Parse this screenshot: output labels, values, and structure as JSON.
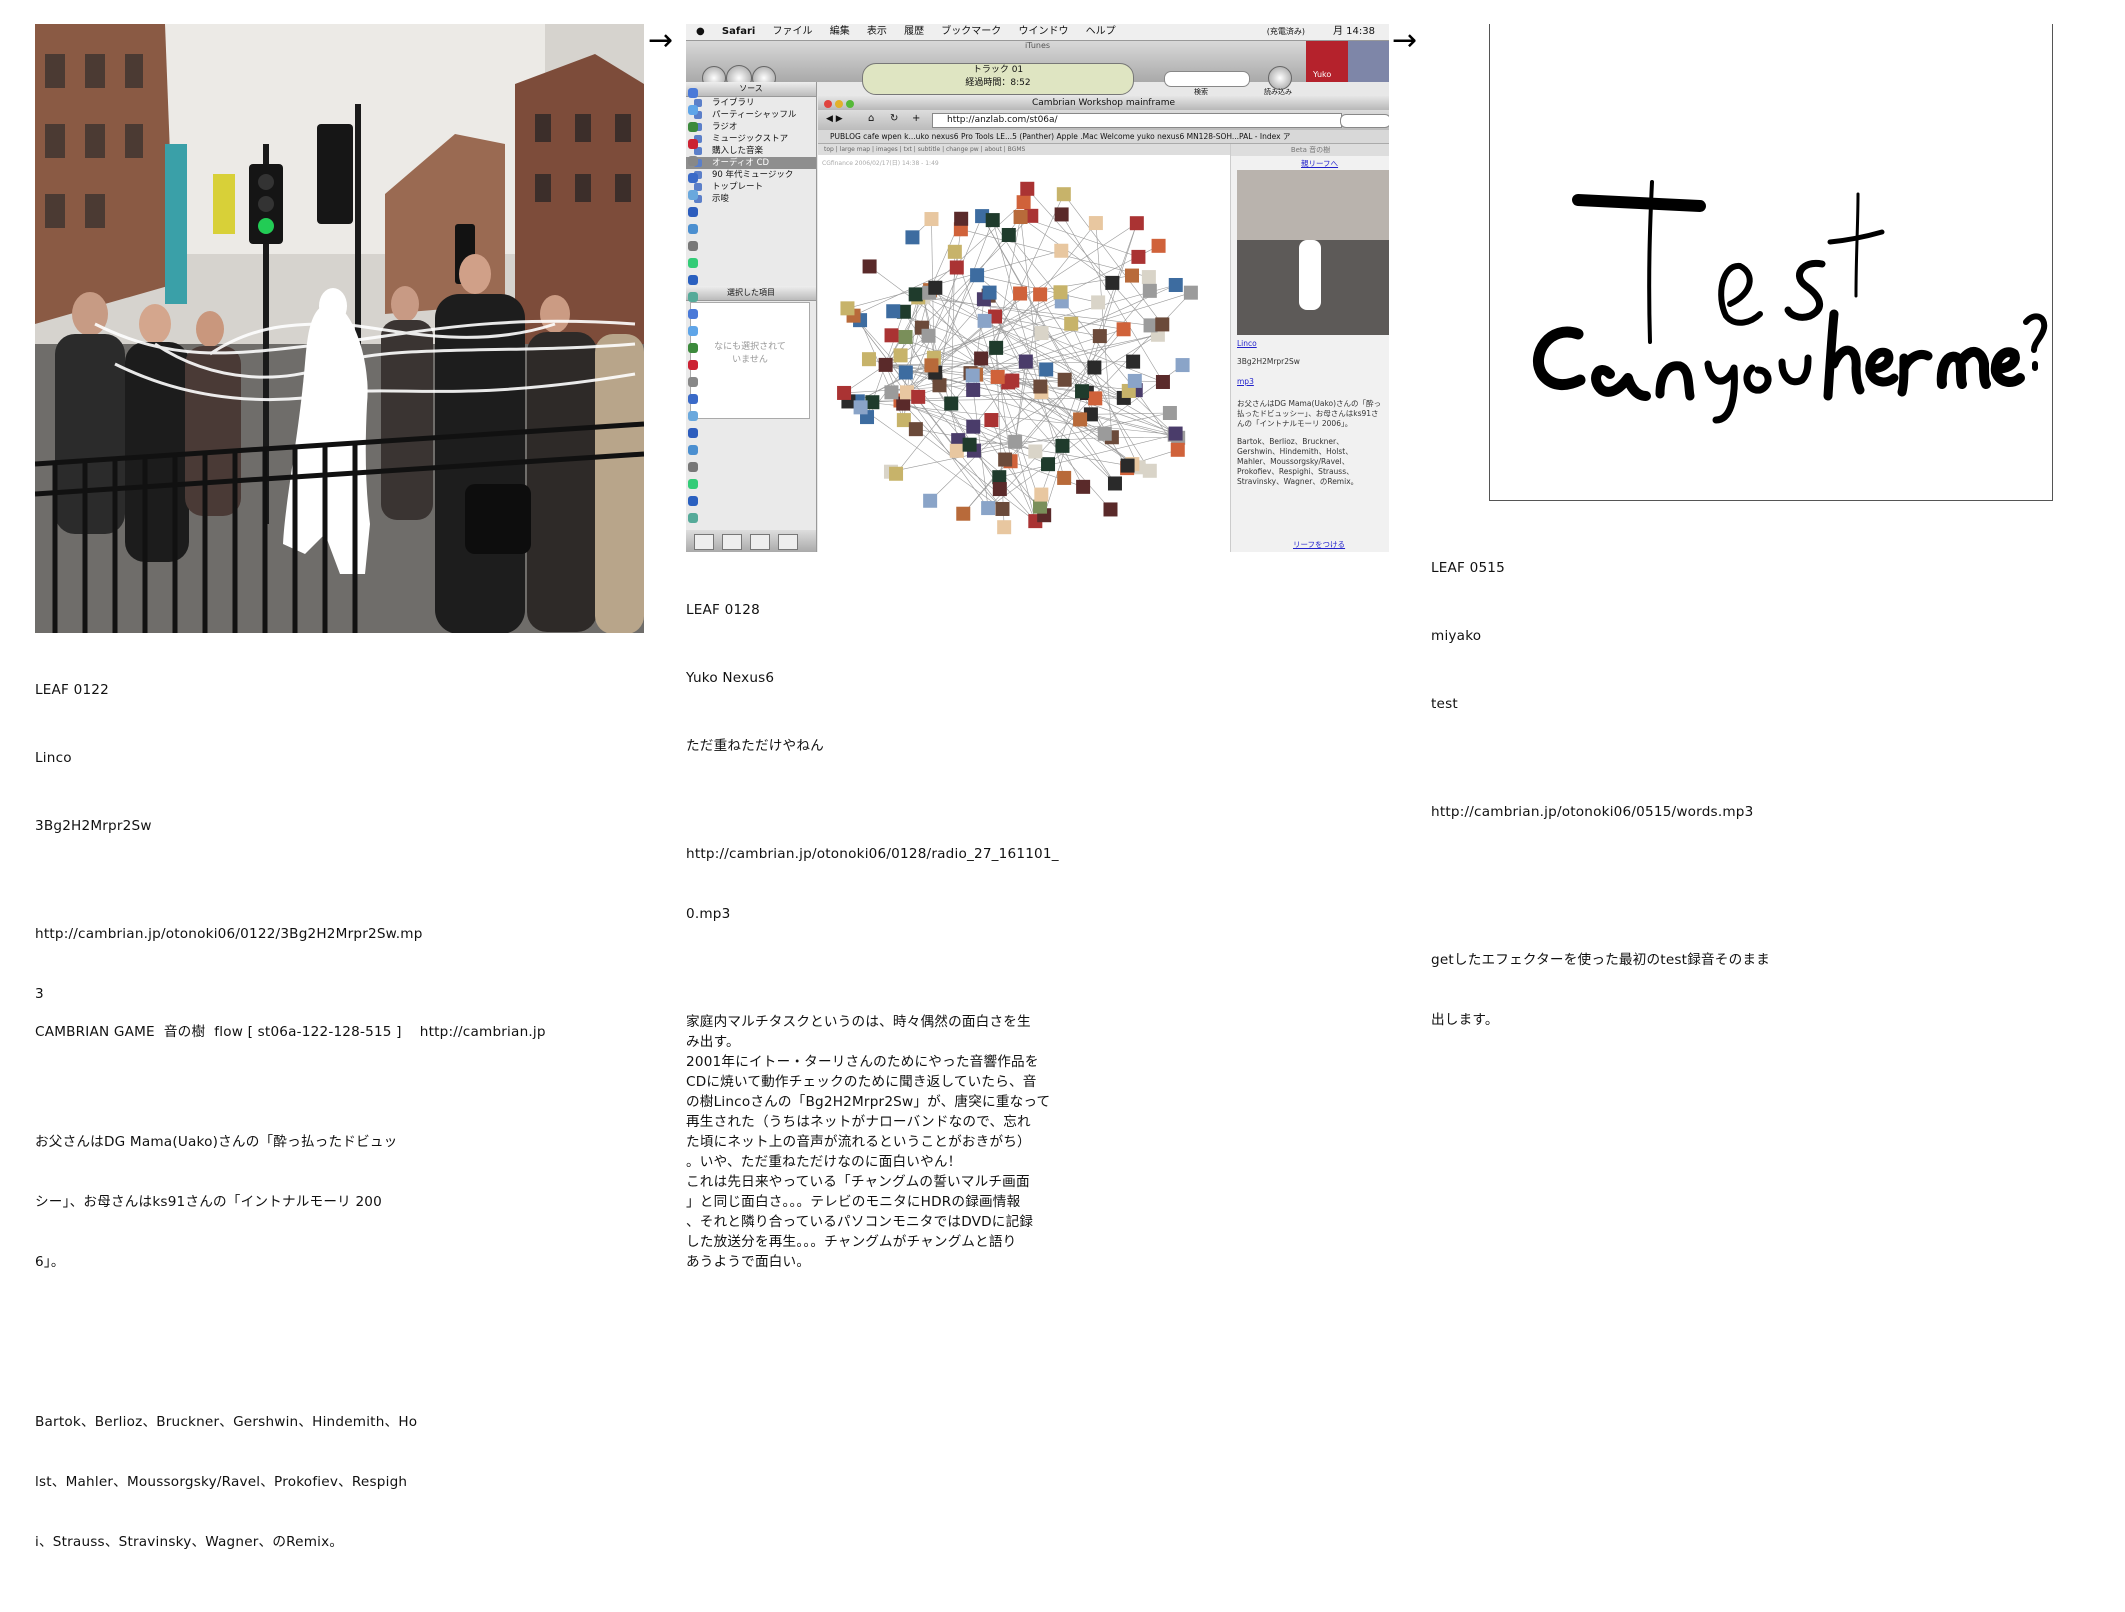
{
  "arrows": [
    "→",
    "→"
  ],
  "leaf0122": {
    "id": "LEAF 0122",
    "author": "Linco",
    "title": "3Bg2H2Mrpr2Sw",
    "url_lines": [
      "http://cambrian.jp/otonoki06/0122/3Bg2H2Mrpr2Sw.mp",
      "3"
    ],
    "desc_lines": [
      "お父さんはDG Mama(Uako)さんの「酔っ払ったドビュッ",
      "シー」、お母さんはks91さんの「イントナルモーリ 200",
      "6」。"
    ],
    "composers_lines": [
      "Bartok、Berlioz、Bruckner、Gershwin、Hindemith、Ho",
      "lst、Mahler、Moussorgsky/Ravel、Prokofiev、Respigh",
      "i、Strauss、Stravinsky、Wagner、のRemix。"
    ]
  },
  "leaf0128": {
    "id": "LEAF 0128",
    "author": "Yuko Nexus6",
    "title": "ただ重ねただけやねん",
    "url_lines": [
      "http://cambrian.jp/otonoki06/0128/radio_27_161101_",
      "0.mp3"
    ],
    "desc_lines": [
      "家庭内マルチタスクというのは、時々偶然の面白さを生",
      "み出す。",
      "2001年にイトー・ターリさんのためにやった音響作品を",
      "CDに焼いて動作チェックのために聞き返していたら、音",
      "の樹Lincoさんの「Bg2H2Mrpr2Sw」が、唐突に重なって",
      "再生された（うちはネットがナローバンドなので、忘れ",
      "た頃にネット上の音声が流れるということがおきがち）",
      "。いや、ただ重ねただけなのに面白いやん！",
      "これは先日来やっている「チャングムの誓いマルチ画面",
      "」と同じ面白さ。。。テレビのモニタにHDRの録画情報",
      "、それと隣り合っているパソコンモニタではDVDに記録",
      "した放送分を再生。。。チャングムがチャングムと語り",
      "あうようで面白い。"
    ],
    "screenshot": {
      "menubar": [
        "Safari",
        "ファイル",
        "編集",
        "表示",
        "履歴",
        "ブックマーク",
        "ウインドウ",
        "ヘルプ"
      ],
      "clock": "月 14:38",
      "battery": "(充電済み)",
      "itunes_title": "iTunes",
      "lcd_track": "トラック 01",
      "lcd_time": "経過時間：8:52",
      "search_label": "検索",
      "browse_label": "読み込み",
      "eject_label": "Yuko",
      "source_header": "ソース",
      "sources": [
        "ライブラリ",
        "パーティーシャッフル",
        "ラジオ",
        "ミュージックストア",
        "購入した音楽",
        "オーディオ CD",
        "90 年代ミュージック",
        "トップレート",
        "示唆"
      ],
      "selected_source_index": 5,
      "artwork_header": "選択した項目",
      "artwork_empty": [
        "なにも選択されて",
        "いません"
      ],
      "window_title": "Cambrian Workshop mainframe",
      "url": "http://anzlab.com/st06a/",
      "bookmarks": "PUBLOG   cafe wpen k...uko nexus6   Pro Tools LE...5 (Panther)   Apple .Mac Welcome   yuko nexus6   MN128-SOH...PAL - Index   ア",
      "tabs_text": "top | large map | images | txt | subtitle | change pw | about | BGMS",
      "tree_caption": "CGfinance 2006/02/17(日) 14:38 - 1:49",
      "side_title": "Beta 音の樹",
      "side_link1": "親リーフへ",
      "side_link2": "Linco",
      "side_name": "3Bg2H2Mrpr2Sw",
      "side_link3": "mp3",
      "side_desc": "お父さんはDG Mama(Uako)さんの「酔っ払ったドビュッシー」、お母さんはks91さんの「イントナルモーリ 2006」。",
      "side_comp": "Bartok、Berlioz、Bruckner、Gershwin、Hindemith、Holst、Mahler、Moussorgsky/Ravel、Prokofiev、Respighi、Strauss、Stravinsky、Wagner、のRemix。",
      "side_link4": "リーフをつける"
    }
  },
  "leaf0515": {
    "id": "LEAF 0515",
    "author": "miyako",
    "title": "test",
    "url_lines": [
      "http://cambrian.jp/otonoki06/0515/words.mp3"
    ],
    "desc_lines": [
      "getしたエフェクターを使った最初のtest録音そのまま",
      "出します。"
    ],
    "drawing_text": [
      "Test",
      "Can you hear me?"
    ]
  },
  "footer": "CAMBRIAN GAME  音の樹  flow [ st06a-122-128-515 ]    http://cambrian.jp",
  "colors": {
    "text": "#111111",
    "link": "#2222cc",
    "lcd": "#dfe5c2"
  }
}
